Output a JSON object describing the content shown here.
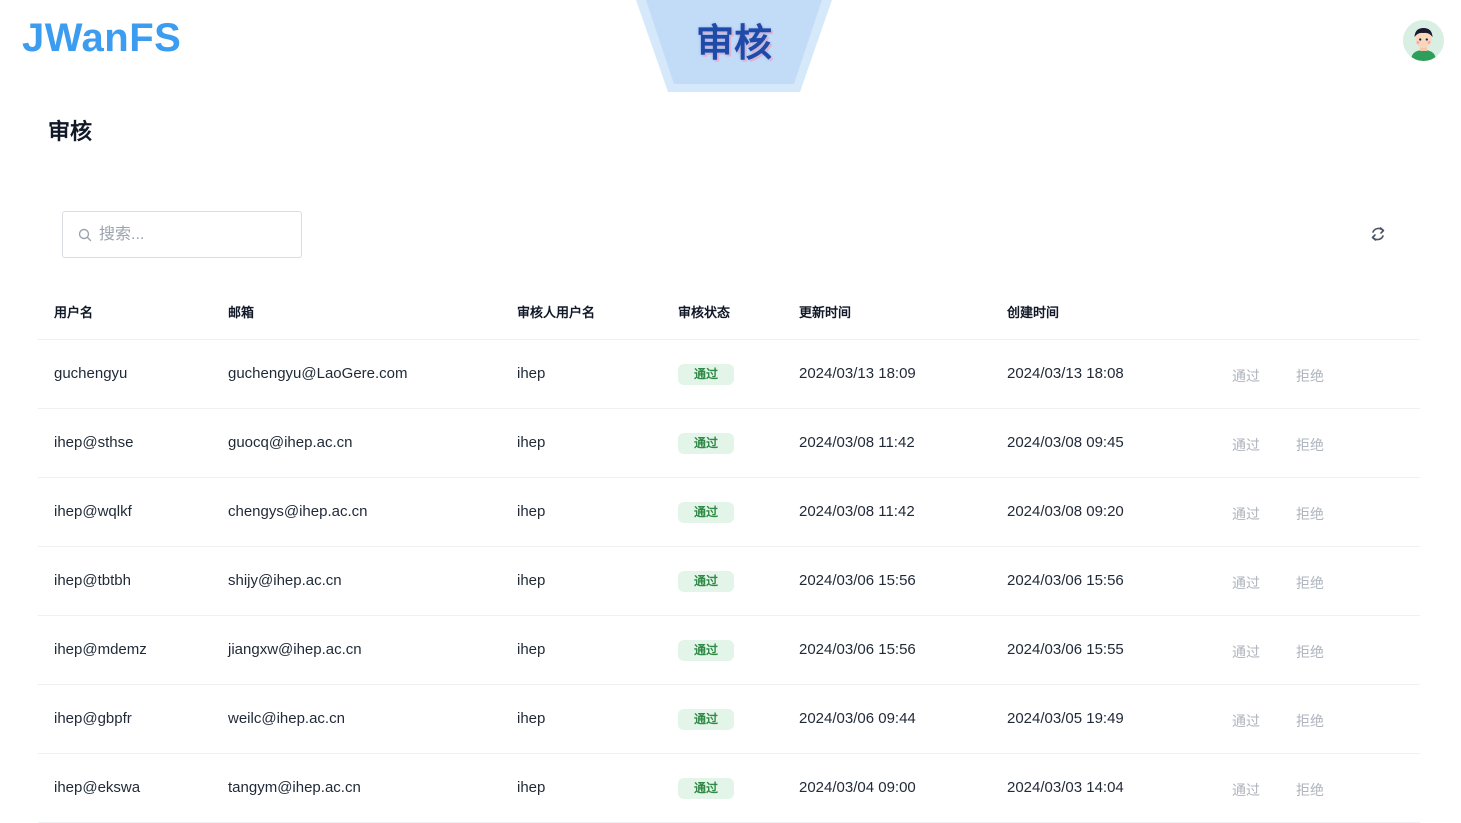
{
  "header": {
    "logo": "JWanFS",
    "banner_title": "审核",
    "avatar_icon": "user-avatar-icon"
  },
  "page": {
    "title": "审核"
  },
  "toolbar": {
    "search_placeholder": "搜索...",
    "search_value": "",
    "refresh_icon": "refresh-icon"
  },
  "table": {
    "columns": [
      "用户名",
      "邮箱",
      "审核人用户名",
      "审核状态",
      "更新时间",
      "创建时间"
    ],
    "rows": [
      {
        "username": "guchengyu",
        "email": "guchengyu@LaoGere.com",
        "reviewer": "ihep",
        "status": "通过",
        "updated": "2024/03/13 18:09",
        "created": "2024/03/13 18:08",
        "approve": "通过",
        "reject": "拒绝"
      },
      {
        "username": "ihep@sthse",
        "email": "guocq@ihep.ac.cn",
        "reviewer": "ihep",
        "status": "通过",
        "updated": "2024/03/08 11:42",
        "created": "2024/03/08 09:45",
        "approve": "通过",
        "reject": "拒绝"
      },
      {
        "username": "ihep@wqlkf",
        "email": "chengys@ihep.ac.cn",
        "reviewer": "ihep",
        "status": "通过",
        "updated": "2024/03/08 11:42",
        "created": "2024/03/08 09:20",
        "approve": "通过",
        "reject": "拒绝"
      },
      {
        "username": "ihep@tbtbh",
        "email": "shijy@ihep.ac.cn",
        "reviewer": "ihep",
        "status": "通过",
        "updated": "2024/03/06 15:56",
        "created": "2024/03/06 15:56",
        "approve": "通过",
        "reject": "拒绝"
      },
      {
        "username": "ihep@mdemz",
        "email": "jiangxw@ihep.ac.cn",
        "reviewer": "ihep",
        "status": "通过",
        "updated": "2024/03/06 15:56",
        "created": "2024/03/06 15:55",
        "approve": "通过",
        "reject": "拒绝"
      },
      {
        "username": "ihep@gbpfr",
        "email": "weilc@ihep.ac.cn",
        "reviewer": "ihep",
        "status": "通过",
        "updated": "2024/03/06 09:44",
        "created": "2024/03/05 19:49",
        "approve": "通过",
        "reject": "拒绝"
      },
      {
        "username": "ihep@ekswa",
        "email": "tangym@ihep.ac.cn",
        "reviewer": "ihep",
        "status": "通过",
        "updated": "2024/03/04 09:00",
        "created": "2024/03/03 14:04",
        "approve": "通过",
        "reject": "拒绝"
      }
    ]
  },
  "colors": {
    "logo": "#3b9cf0",
    "banner_text": "#1e4aa8",
    "status_bg": "#e3f4e8",
    "status_text": "#2f8a46",
    "action_text": "#aeb4bd"
  }
}
